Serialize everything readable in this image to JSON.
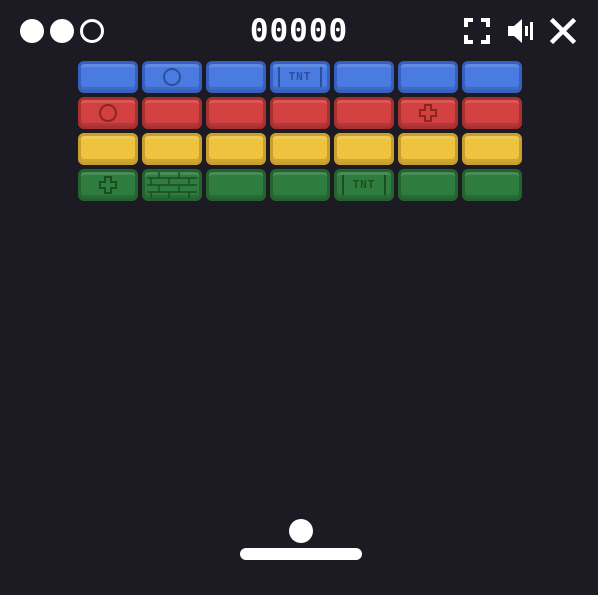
{
  "hud": {
    "score": "00000",
    "lives": {
      "total": 3,
      "remaining": 2
    },
    "buttons": [
      {
        "name": "fullscreen-button",
        "icon": "fullscreen-icon"
      },
      {
        "name": "sound-button",
        "icon": "speaker-icon"
      },
      {
        "name": "close-button",
        "icon": "close-icon"
      }
    ]
  },
  "colors": {
    "background": "#1c1a22",
    "white": "#ffffff",
    "blue": {
      "fill": "#4a7be0",
      "border": "#3560bf",
      "mark": "#2c4e9e"
    },
    "red": {
      "fill": "#d24040",
      "border": "#a93030",
      "mark": "#8c2424"
    },
    "yellow": {
      "fill": "#eec33f",
      "border": "#c99e2a",
      "mark": "#a88420"
    },
    "green": {
      "fill": "#2f7d3e",
      "border": "#24622f",
      "mark": "#1b4d25"
    }
  },
  "bricks": {
    "rows": [
      {
        "color": "blue",
        "cells": [
          {
            "type": "plain"
          },
          {
            "type": "circle",
            "icon": "multiball-icon"
          },
          {
            "type": "plain"
          },
          {
            "type": "tnt",
            "label": "TNT"
          },
          {
            "type": "plain"
          },
          {
            "type": "plain"
          },
          {
            "type": "plain"
          }
        ]
      },
      {
        "color": "red",
        "cells": [
          {
            "type": "circle",
            "icon": "multiball-icon"
          },
          {
            "type": "plain"
          },
          {
            "type": "plain"
          },
          {
            "type": "plain"
          },
          {
            "type": "plain"
          },
          {
            "type": "plus",
            "icon": "plus-icon"
          },
          {
            "type": "plain"
          }
        ]
      },
      {
        "color": "yellow",
        "cells": [
          {
            "type": "plain"
          },
          {
            "type": "plain"
          },
          {
            "type": "plain"
          },
          {
            "type": "plain"
          },
          {
            "type": "plain"
          },
          {
            "type": "plain"
          },
          {
            "type": "plain"
          }
        ]
      },
      {
        "color": "green",
        "cells": [
          {
            "type": "plus",
            "icon": "plus-icon"
          },
          {
            "type": "wall",
            "icon": "brick-wall-icon"
          },
          {
            "type": "plain"
          },
          {
            "type": "plain"
          },
          {
            "type": "tnt",
            "label": "TNT"
          },
          {
            "type": "plain"
          },
          {
            "type": "plain"
          }
        ]
      }
    ]
  }
}
